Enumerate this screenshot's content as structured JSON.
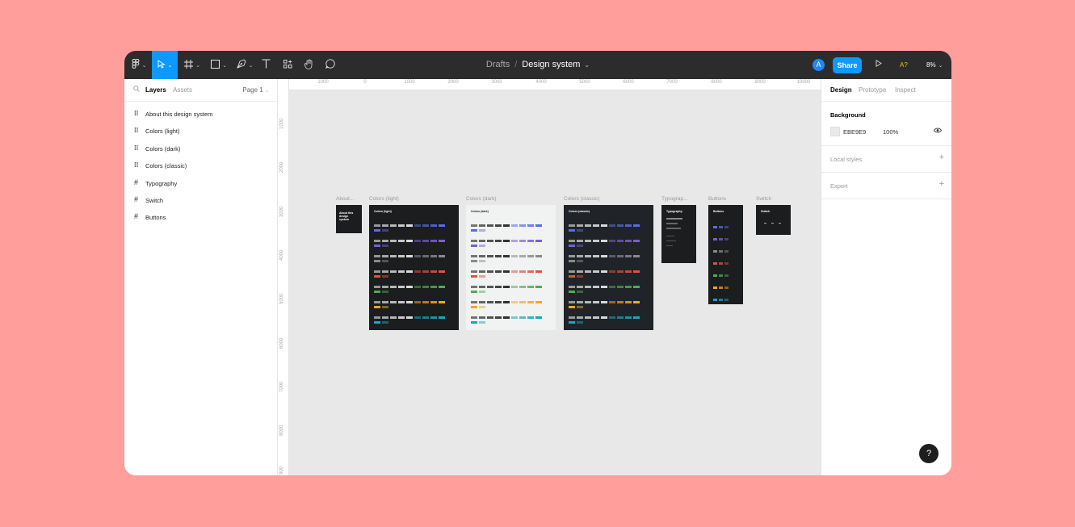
{
  "toolbar": {
    "breadcrumb": {
      "folder": "Drafts",
      "separator": "/",
      "file": "Design system"
    },
    "avatar": "A",
    "share": "Share",
    "a11y": "A?",
    "zoom": "8%",
    "colors": {
      "bar": "#2C2C2C",
      "accent": "#0D99FF"
    }
  },
  "left_panel": {
    "tabs": {
      "layers": "Layers",
      "assets": "Assets"
    },
    "page": "Page 1",
    "layers": [
      {
        "icon": "section-icon",
        "label": "About this design system"
      },
      {
        "icon": "section-icon",
        "label": "Colors (light)"
      },
      {
        "icon": "section-icon",
        "label": "Colors (dark)"
      },
      {
        "icon": "section-icon",
        "label": "Colors (classic)"
      },
      {
        "icon": "frame-icon",
        "label": "Typography"
      },
      {
        "icon": "frame-icon",
        "label": "Switch"
      },
      {
        "icon": "frame-icon",
        "label": "Buttons"
      }
    ]
  },
  "canvas": {
    "ruler_top": [
      "-1000",
      "0",
      "1000",
      "2000",
      "3000",
      "4000",
      "5000",
      "6000",
      "7000",
      "8000",
      "9000",
      "10000"
    ],
    "ruler_left": [
      "1000",
      "2000",
      "3000",
      "4000",
      "5000",
      "6000",
      "7000",
      "8000",
      "900"
    ],
    "frames": [
      {
        "label": "About...",
        "title": "About this design system"
      },
      {
        "label": "Colors (light)",
        "title": "Colors (light)"
      },
      {
        "label": "Colors (dark)",
        "title": "Colors (dark)"
      },
      {
        "label": "Colors (classic)",
        "title": "Colors (classic)"
      },
      {
        "label": "Typograp...",
        "title": "Typography"
      },
      {
        "label": "Buttons",
        "title": "Buttons"
      },
      {
        "label": "Switch",
        "title": "Switch"
      }
    ],
    "background": "#E9E8E9",
    "swatch_colors": [
      "#5B6BE8",
      "#7B5CE0",
      "#8A8A8A",
      "#E0533C",
      "#4CAF50",
      "#F5A524",
      "#1BA5C4"
    ]
  },
  "right_panel": {
    "tabs": {
      "design": "Design",
      "prototype": "Prototype",
      "inspect": "Inspect"
    },
    "background": {
      "heading": "Background",
      "hex": "EBE9E9",
      "opacity": "100%"
    },
    "local_styles": "Local styles",
    "export": "Export",
    "help": "?"
  }
}
